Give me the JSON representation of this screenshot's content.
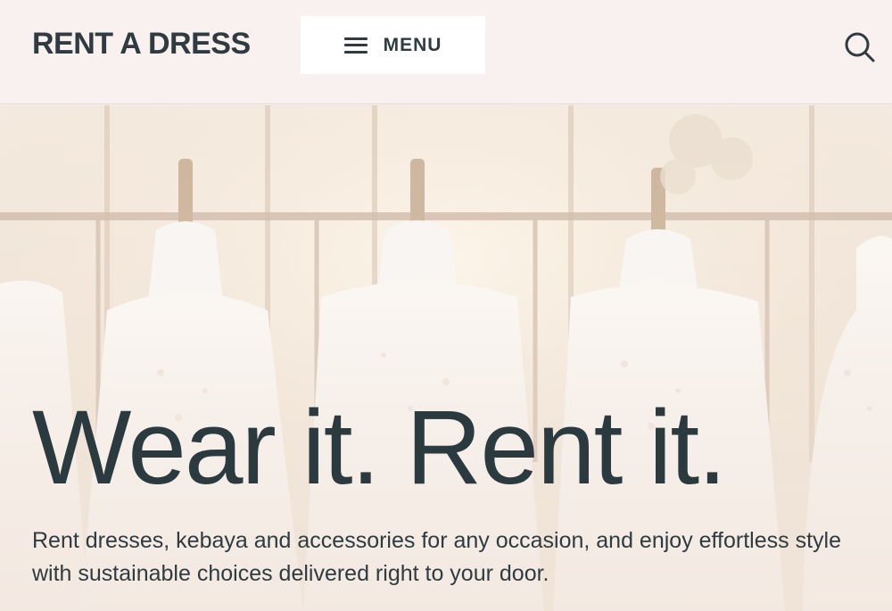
{
  "header": {
    "brand": "RENT A DRESS",
    "menu_label": "MENU"
  },
  "hero": {
    "title": "Wear it. Rent it.",
    "text": "Rent dresses, kebaya and accessories for any occasion, and enjoy effortless style with sustainable choices delivered right to your door."
  },
  "icons": {
    "menu": "hamburger-icon",
    "search": "search-icon"
  },
  "colors": {
    "header_bg": "#f8f1f0",
    "text_dark": "#2f3b40",
    "menu_bg": "#ffffff"
  }
}
